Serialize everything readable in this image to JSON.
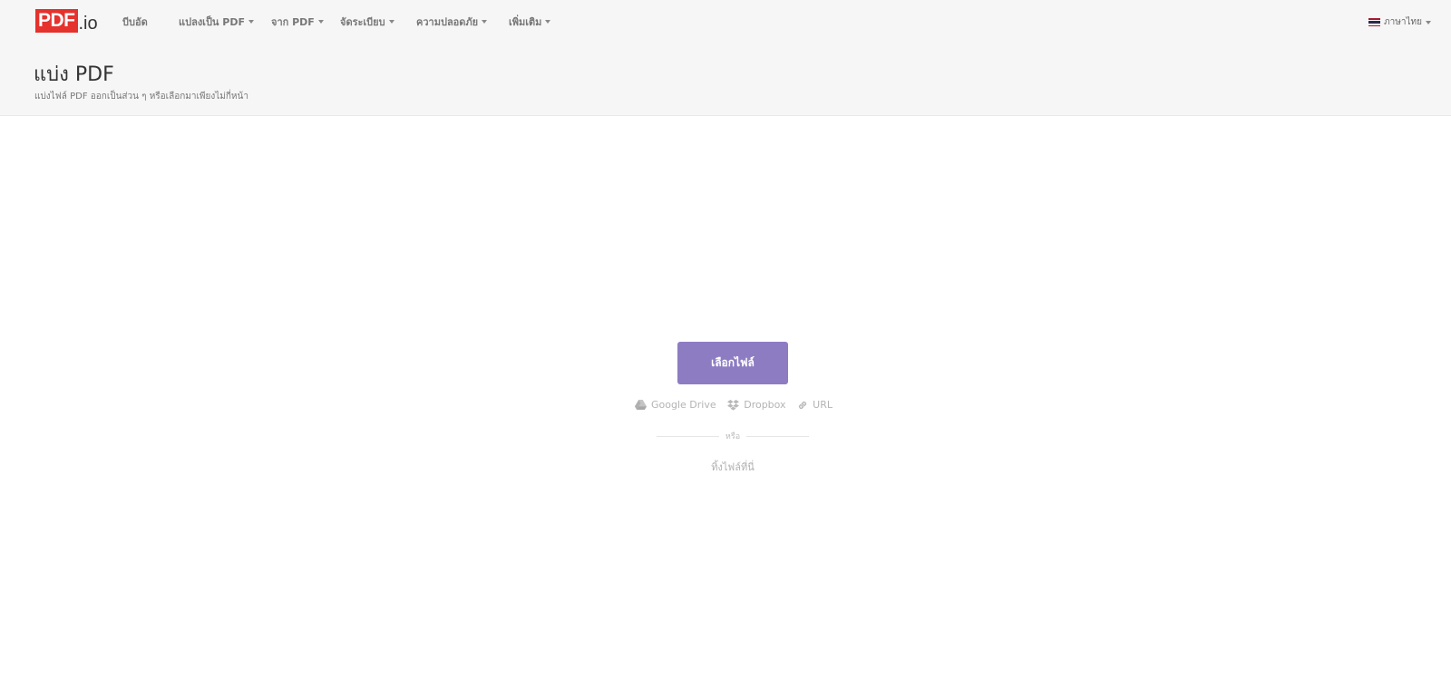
{
  "header": {
    "logo": {
      "main": "PDF",
      "ext": ".io"
    },
    "nav": [
      {
        "label": "บีบอัด",
        "dropdown": false
      },
      {
        "label": "แปลงเป็น PDF",
        "dropdown": true
      },
      {
        "label": "จาก PDF",
        "dropdown": true
      },
      {
        "label": "จัดระเบียบ",
        "dropdown": true
      },
      {
        "label": "ความปลอดภัย",
        "dropdown": true
      },
      {
        "label": "เพิ่มเติม",
        "dropdown": true
      }
    ],
    "language": {
      "label": "ภาษาไทย",
      "flag_colors": [
        "#a51931",
        "#f4f5f8",
        "#2d2a4a",
        "#f4f5f8",
        "#a51931"
      ]
    }
  },
  "page": {
    "title": "แบ่ง PDF",
    "subtitle": "แบ่งไฟล์ PDF ออกเป็นส่วน ๆ หรือเลือกมาเพียงไม่กี่หน้า"
  },
  "upload": {
    "button_label": "เลือกไฟล์",
    "sources": [
      {
        "label": "Google Drive",
        "icon": "google-drive-icon"
      },
      {
        "label": "Dropbox",
        "icon": "dropbox-icon"
      },
      {
        "label": "URL",
        "icon": "link-icon"
      }
    ],
    "or_text": "หรือ",
    "drop_text": "ทิ้งไฟล์ที่นี่"
  },
  "colors": {
    "accent": "#8e7cc3",
    "logo_red": "#e5322d",
    "header_bg": "#f6f6f6"
  }
}
